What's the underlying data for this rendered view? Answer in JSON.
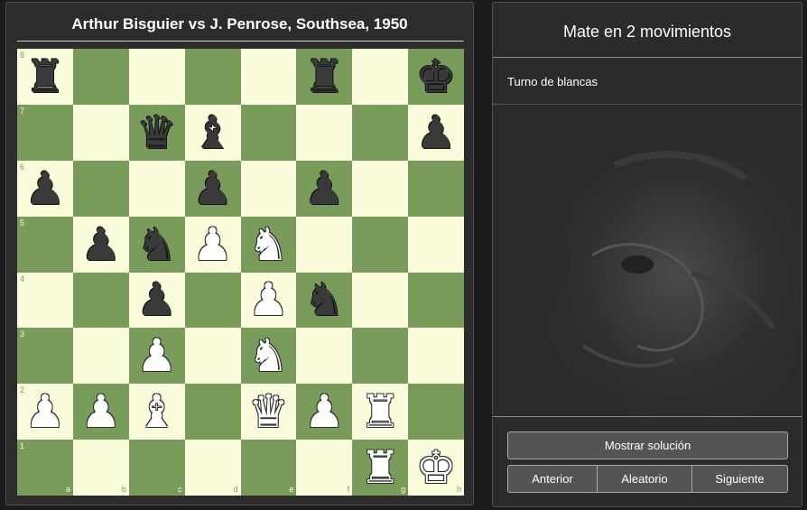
{
  "game": {
    "title": "Arthur Bisguier vs J. Penrose, Southsea, 1950"
  },
  "board": {
    "colors": {
      "light": "#fbfcdc",
      "dark": "#7a9c5b"
    },
    "files": [
      "a",
      "b",
      "c",
      "d",
      "e",
      "f",
      "g",
      "h"
    ],
    "ranks": [
      "8",
      "7",
      "6",
      "5",
      "4",
      "3",
      "2",
      "1"
    ],
    "position": [
      [
        "bR",
        "",
        "",
        "",
        "",
        "bR",
        "",
        "bK"
      ],
      [
        "",
        "",
        "bQ",
        "bB",
        "",
        "",
        "",
        "bP"
      ],
      [
        "bP",
        "",
        "",
        "bP",
        "",
        "bP",
        "",
        ""
      ],
      [
        "",
        "bP",
        "bN",
        "wP",
        "wN",
        "",
        "",
        ""
      ],
      [
        "",
        "",
        "bP",
        "",
        "wP",
        "bN",
        "",
        ""
      ],
      [
        "",
        "",
        "wP",
        "",
        "wN",
        "",
        "",
        ""
      ],
      [
        "wP",
        "wP",
        "wB",
        "",
        "wQ",
        "wP",
        "wR",
        ""
      ],
      [
        "",
        "",
        "",
        "",
        "",
        "",
        "wR",
        "wK"
      ]
    ],
    "glyphs": {
      "K": "♚",
      "Q": "♛",
      "R": "♜",
      "B": "♝",
      "N": "♞",
      "P": "♟"
    },
    "piece_names": {
      "K": "king",
      "Q": "queen",
      "R": "rook",
      "B": "bishop",
      "N": "knight",
      "P": "pawn"
    }
  },
  "puzzle": {
    "title": "Mate en 2 movimientos",
    "turn": "Turno de blancas"
  },
  "buttons": {
    "show_solution": "Mostrar solución",
    "previous": "Anterior",
    "random": "Aleatorio",
    "next": "Siguiente"
  }
}
